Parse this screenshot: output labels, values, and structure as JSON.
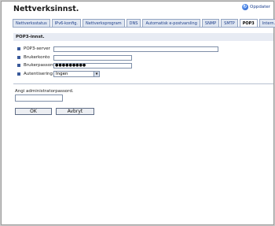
{
  "header": {
    "title": "Nettverksinnst.",
    "refresh_label": "Oppdater"
  },
  "tabs": [
    {
      "label": "Nettverksstatus",
      "active": false
    },
    {
      "label": "IPv6-konfig.",
      "active": false
    },
    {
      "label": "Nettverksprogram",
      "active": false
    },
    {
      "label": "DNS",
      "active": false
    },
    {
      "label": "Automatisk e-postvarsling",
      "active": false
    },
    {
      "label": "SNMP",
      "active": false
    },
    {
      "label": "SMTP",
      "active": false
    },
    {
      "label": "POP3",
      "active": true
    },
    {
      "label": "Intern.faks",
      "active": false
    }
  ],
  "section": {
    "title": "POP3-innst."
  },
  "form": {
    "server_label": "POP3-server",
    "server_value": "",
    "account_label": "Brukerkonto",
    "account_value": "",
    "password_label": "Brukerpassord",
    "password_value": "●●●●●●●●●",
    "auth_label": "Autentisering",
    "auth_value": "Ingen"
  },
  "admin": {
    "label": "Angi administratorpassord.",
    "value": ""
  },
  "buttons": {
    "ok": "OK",
    "cancel": "Avbryt"
  },
  "colors": {
    "tab_text": "#1d3e8a",
    "section_bg": "#e7ebf3",
    "bullet": "#39599a"
  }
}
